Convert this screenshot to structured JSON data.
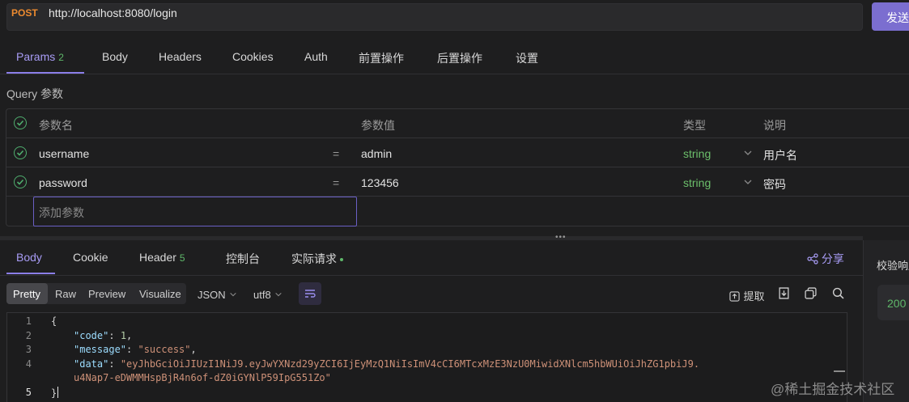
{
  "request": {
    "method": "POST",
    "url": "http://localhost:8080/login",
    "send_label": "发送"
  },
  "request_tabs": [
    {
      "label": "Params",
      "badge": "2"
    },
    {
      "label": "Body"
    },
    {
      "label": "Headers"
    },
    {
      "label": "Cookies"
    },
    {
      "label": "Auth"
    },
    {
      "label": "前置操作"
    },
    {
      "label": "后置操作"
    },
    {
      "label": "设置"
    }
  ],
  "query": {
    "section_label": "Query 参数",
    "headers": {
      "name": "参数名",
      "value": "参数值",
      "type": "类型",
      "desc": "说明"
    },
    "rows": [
      {
        "name": "username",
        "value": "admin",
        "type": "string",
        "desc": "用户名"
      },
      {
        "name": "password",
        "value": "123456",
        "type": "string",
        "desc": "密码"
      }
    ],
    "add_placeholder": "添加参数"
  },
  "response_tabs": [
    {
      "label": "Body"
    },
    {
      "label": "Cookie"
    },
    {
      "label": "Header",
      "badge": "5"
    },
    {
      "label": "控制台"
    },
    {
      "label": "实际请求"
    }
  ],
  "share_label": "分享",
  "format": {
    "modes": [
      "Pretty",
      "Raw",
      "Preview",
      "Visualize"
    ],
    "active": "Pretty",
    "type": "JSON",
    "encoding": "utf8",
    "extract_label": "提取"
  },
  "code_lines": [
    "1",
    "2",
    "3",
    "4",
    "",
    "5"
  ],
  "response_json": {
    "code_key": "\"code\"",
    "code_val": "1",
    "message_key": "\"message\"",
    "message_val": "\"success\"",
    "data_key": "\"data\"",
    "data_val_1": "\"eyJhbGciOiJIUzI1NiJ9.eyJwYXNzd29yZCI6IjEyMzQ1NiIsImV4cCI6MTcxMzE3NzU0MiwidXNlcm5hbWUiOiJhZG1pbiJ9.",
    "data_val_2": "u4Nap7-eDWMMHspBjR4n6of-dZ0iGYNlP59IpG551Zo\""
  },
  "right_panel": {
    "label": "校验响应",
    "status": "200"
  },
  "watermark": "@稀土掘金技术社区",
  "colors": {
    "accent": "#8b7ee8",
    "method": "#ec8a2f",
    "success": "#5fb86a"
  }
}
